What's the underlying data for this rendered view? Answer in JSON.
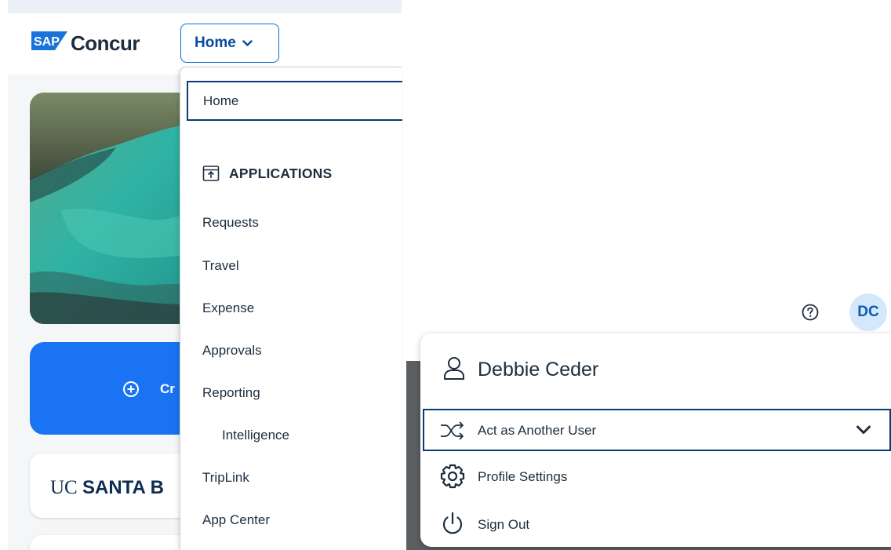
{
  "header": {
    "logo_text": "SAP",
    "brand_name": "Concur",
    "home_button_label": "Home"
  },
  "home_page": {
    "create_button_label": "Cr",
    "organization_name_regular": "UC ",
    "organization_name_bold": "SANTA B"
  },
  "nav_menu": {
    "home_item": "Home",
    "applications_header": "APPLICATIONS",
    "items": [
      {
        "label": "Requests"
      },
      {
        "label": "Travel"
      },
      {
        "label": "Expense"
      },
      {
        "label": "Approvals"
      },
      {
        "label": "Reporting"
      },
      {
        "label": "Intelligence"
      },
      {
        "label": "TripLink"
      },
      {
        "label": "App Center"
      }
    ]
  },
  "utility": {
    "help_icon": "question-circle-icon",
    "avatar_initials": "DC"
  },
  "profile_menu": {
    "user_name": "Debbie Ceder",
    "act_as_label": "Act as Another User",
    "profile_settings_label": "Profile Settings",
    "sign_out_label": "Sign Out"
  },
  "colors": {
    "brand_blue": "#0a6ed1",
    "primary_button": "#1a73f2",
    "focus_border": "#0b3a78",
    "avatar_bg": "#d5e8fb",
    "text": "#1d2d3e"
  }
}
